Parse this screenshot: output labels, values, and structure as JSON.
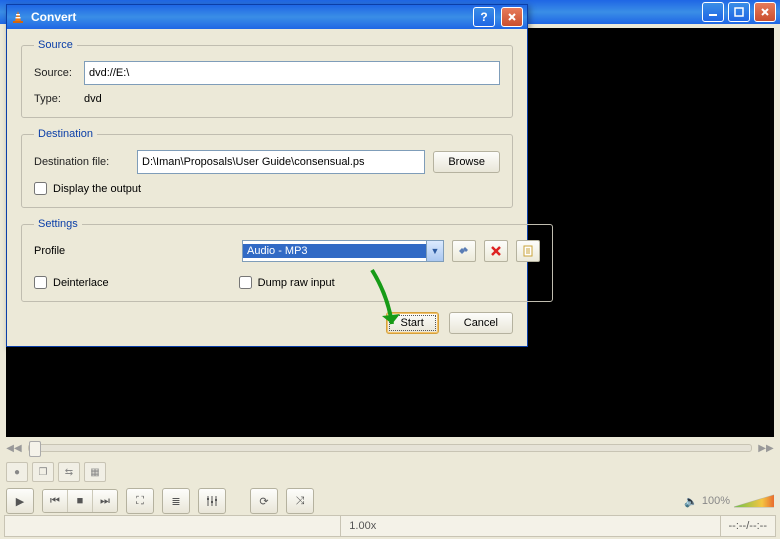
{
  "main_window": {
    "playback_speed": "1.00x",
    "time_display": "--:--/--:--",
    "volume_percent": "100%"
  },
  "dialog": {
    "title": "Convert",
    "source_group": {
      "legend": "Source",
      "source_label": "Source:",
      "source_value": "dvd://E:\\",
      "type_label": "Type:",
      "type_value": "dvd"
    },
    "dest_group": {
      "legend": "Destination",
      "dest_label": "Destination file:",
      "dest_value": "D:\\Iman\\Proposals\\User Guide\\consensual.ps",
      "browse_label": "Browse",
      "display_output_label": "Display the output"
    },
    "settings_group": {
      "legend": "Settings",
      "profile_label": "Profile",
      "profile_value": "Audio - MP3",
      "deinterlace_label": "Deinterlace",
      "dump_label": "Dump raw input"
    },
    "footer": {
      "start_label": "Start",
      "cancel_label": "Cancel"
    }
  }
}
